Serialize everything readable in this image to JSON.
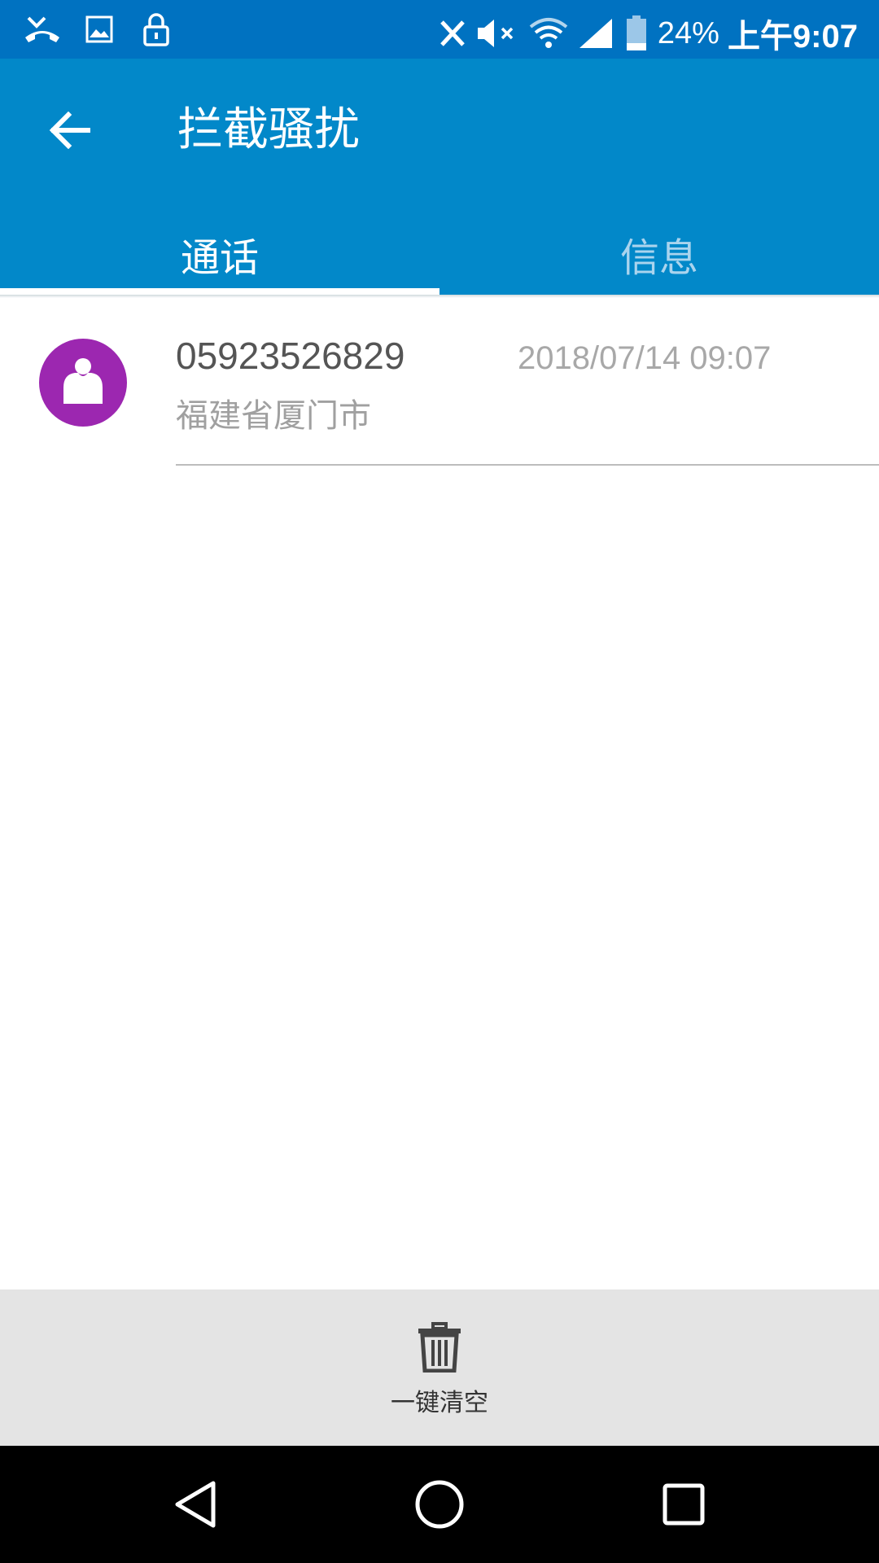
{
  "status_bar": {
    "battery_percent": "24%",
    "time": "上午9:07",
    "icons": [
      "missed-call-icon",
      "image-icon",
      "lock-icon",
      "x-icon",
      "mute-icon",
      "wifi-icon",
      "signal-icon",
      "battery-icon"
    ]
  },
  "appbar": {
    "title": "拦截骚扰",
    "tabs": [
      {
        "label": "通话",
        "active": true
      },
      {
        "label": "信息",
        "active": false
      }
    ]
  },
  "list": {
    "items": [
      {
        "number": "05923526829",
        "location": "福建省厦门市",
        "time": "2018/07/14 09:07"
      }
    ]
  },
  "bottom": {
    "clear_all_label": "一键清空"
  },
  "colors": {
    "status_bar": "#0072c1",
    "app_bar": "#0288c9",
    "avatar": "#9c27b0",
    "bottom_bar": "#e4e4e4"
  }
}
